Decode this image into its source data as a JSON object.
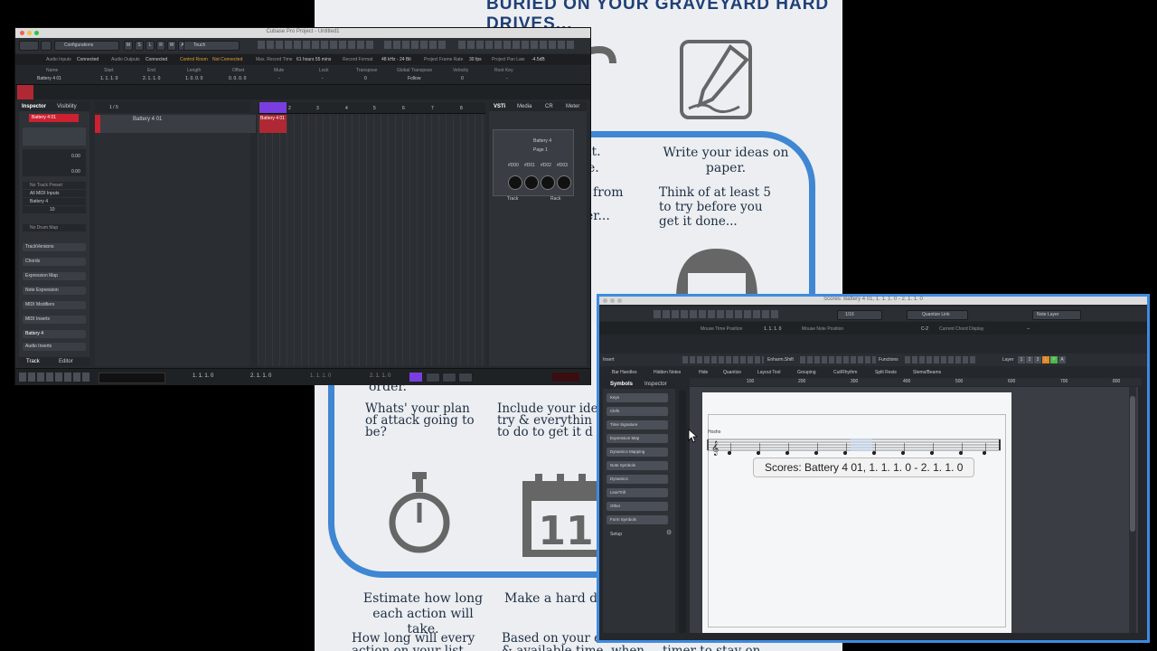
{
  "poster": {
    "heading": "BURIED ON YOUR GRAVEYARD HARD DRIVES...",
    "col2_title": "Write your ideas on paper.",
    "col2_body": "Think of at least 5 to try before you get it done...",
    "partial_1": "it.",
    "partial_2": "e.",
    "partial_3": "from",
    "partial_4": "er...",
    "partial_5": "order.",
    "plan_q": "Whats' your plan of attack going to be?",
    "include": "Include your ide try & everythin to do to get it d",
    "estimate": "Estimate how long each action will take.",
    "make": "Make a hard de",
    "bottom1": "How long will every action on your list",
    "bottom2": "Based on your estimates & available time, when",
    "bottom3": "Use a countdown timer to stay on",
    "calendar_day": "11"
  },
  "project_window": {
    "title": "Cubase Pro Project - Untitled1",
    "toolbar": {
      "configurations": "Configurations",
      "mslrwa": [
        "M",
        "S",
        "L",
        "R",
        "W",
        "A"
      ],
      "touch": "Touch"
    },
    "status": {
      "audio_inputs_label": "Audio Inputs",
      "audio_inputs": "Connected",
      "audio_outputs_label": "Audio Outputs",
      "audio_outputs": "Connected",
      "control_room_label": "Control Room",
      "control_room": "Not Connected",
      "max_record_label": "Max. Record Time",
      "max_record": "61 hours 55 mins",
      "record_format_label": "Record Format",
      "record_format": "48 kHz - 24 Bit",
      "frame_rate_label": "Project Frame Rate",
      "frame_rate": "30 fps",
      "pan_law_label": "Project Pan Law",
      "pan_law": "-4.5dB"
    },
    "info_line": {
      "headers": [
        "Name",
        "Start",
        "End",
        "Length",
        "Offset",
        "Mute",
        "Lock",
        "Transpose",
        "Global Transpose",
        "Velocity",
        "Root Key"
      ],
      "values": [
        "Battery 4 01",
        "1. 1. 1.   0",
        "2. 1. 1.   0",
        "1. 0. 0.   0",
        "0. 0. 0.   0",
        "-",
        "-",
        "0",
        "Follow",
        "0",
        "-"
      ]
    },
    "inspector": {
      "tabs": [
        "Inspector",
        "Visibility"
      ],
      "track_name": "Battery 4 01",
      "vol": "0.00",
      "pan": "0.00",
      "preset": "No Track Preset",
      "input": "All MIDI Inputs",
      "output": "Battery 4",
      "channel": "10",
      "drum_map": "No Drum Map",
      "sections": [
        "TrackVersions",
        "Chords",
        "Expression Map",
        "Note Expression",
        "MIDI Modifiers",
        "MIDI Inserts",
        "Battery 4",
        "Audio Inserts"
      ],
      "bottom_tabs": [
        "Track",
        "Editor"
      ]
    },
    "tracklist": {
      "count": "1 / 5",
      "track_name": "Battery 4 01",
      "part_name": "Battery 4 01",
      "ruler": [
        "1",
        "2",
        "3",
        "4",
        "5",
        "6",
        "7",
        "8"
      ]
    },
    "right_zone": {
      "tabs": [
        "VSTi",
        "Media",
        "CR",
        "Meter"
      ],
      "instrument": "Battery 4",
      "page": "Page 1",
      "knobs": [
        "#D00",
        "#D01",
        "#D02",
        "#D03"
      ],
      "footer": [
        "Track",
        "Rack"
      ]
    },
    "transport": {
      "left_pos": "1. 1. 1.   0",
      "right_pos": "2. 1. 1.   0",
      "pos1": "1. 1. 1.   0",
      "pos2": "2. 1. 1.   0"
    }
  },
  "score_window": {
    "title": "Scores: Battery 4 01, 1. 1. 1.  0 - 2. 1. 1.  0",
    "quantize": "1/16",
    "quantize_link": "Quantize Link",
    "note_layer": "Note Layer",
    "mouse_time_label": "Mouse Time Position",
    "mouse_time": "1. 1. 1.  0",
    "mouse_note_label": "Mouse Note Position",
    "mouse_note": "C-2",
    "chord_label": "Current Chord Display",
    "chord": "--",
    "insert_label": "Insert",
    "enharm": "Enharm.Shift",
    "functions": "Functions",
    "layer": "Layer",
    "layer_nums": [
      "1",
      "2",
      "3",
      "L",
      "P",
      "A"
    ],
    "filters": [
      "Bar Handles",
      "Hidden Notes",
      "Hide",
      "Quantize",
      "Layout Tool",
      "Grouping",
      "Cut/Rhythm",
      "Split Rests",
      "Stems/Beams"
    ],
    "ruler": [
      "100",
      "200",
      "300",
      "400",
      "500",
      "600",
      "700",
      "800"
    ],
    "left_tabs": [
      "Symbols",
      "Inspector"
    ],
    "symbols": [
      "Keys",
      "Clefs",
      "Time Signature",
      "Expression Map",
      "Dynamics Mapping",
      "Note Symbols",
      "Dynamics",
      "Line/Trill",
      "Other",
      "Form Symbols"
    ],
    "setup": "Setup",
    "staff_label": "Hosho",
    "tooltip": "Scores: Battery 4 01, 1. 1. 1.  0 - 2. 1. 1.  0"
  }
}
